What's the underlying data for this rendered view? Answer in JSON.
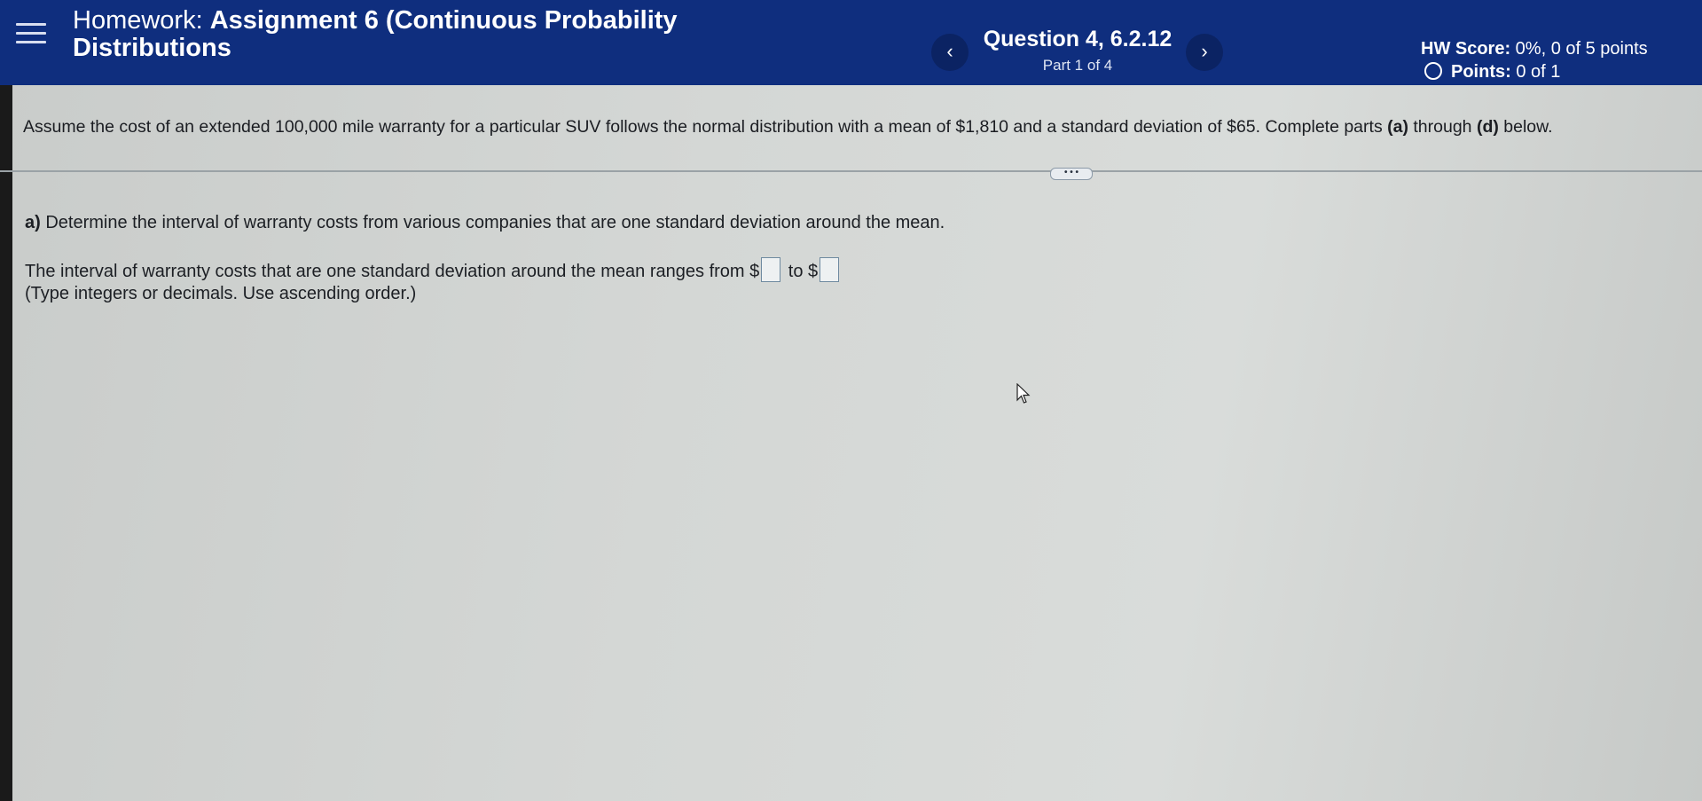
{
  "header": {
    "title_prefix": "Homework: ",
    "title_name": "Assignment 6 (Continuous Probability Distributions",
    "question_title": "Question 4, 6.2.12",
    "question_part": "Part 1 of 4",
    "prev_glyph": "‹",
    "next_glyph": "›",
    "hw_score_label": "HW Score:",
    "hw_score_value": " 0%, 0 of 5 points",
    "points_label": "Points:",
    "points_value": " 0 of 1"
  },
  "problem": {
    "statement_text": "Assume the cost of an extended 100,000 mile warranty for a particular SUV follows the normal distribution with a mean of $1,810 and a standard deviation of $65. Complete parts ",
    "statement_a": "(a)",
    "statement_mid": " through ",
    "statement_d": "(d)",
    "statement_end": " below.",
    "more_label": "• • •"
  },
  "part_a": {
    "letter": "a)",
    "question": " Determine the interval of warranty costs from various companies that are one standard deviation around the mean.",
    "answer_prefix": "The interval of warranty costs that are one standard deviation around the mean ranges from $",
    "answer_mid": " to $",
    "answer_low_value": "",
    "answer_high_value": "",
    "hint": "(Type integers or decimals. Use ascending order.)"
  },
  "colors": {
    "header_bg": "#0f2e7e",
    "nav_button_bg": "#0b2363",
    "text": "#1c1f24"
  }
}
